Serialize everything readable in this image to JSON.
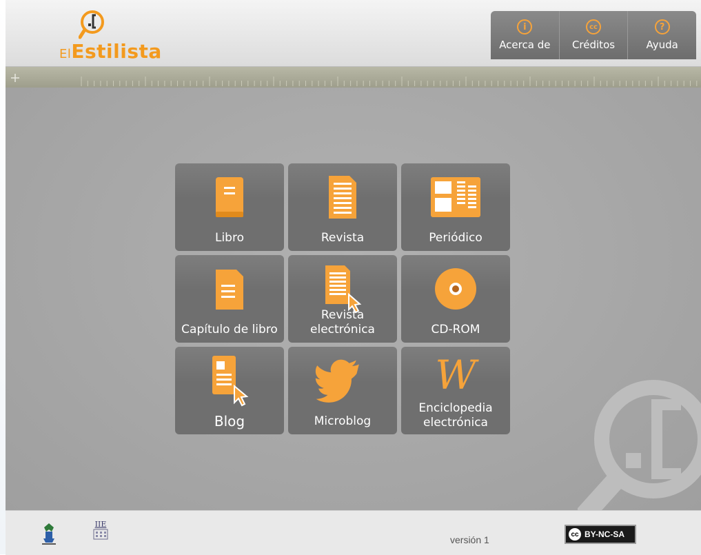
{
  "header": {
    "logo": {
      "prefix": "El",
      "name": "Estilista",
      "mark": ".["
    },
    "nav": [
      {
        "label": "Acerca de",
        "icon": "info-icon",
        "glyph": "i"
      },
      {
        "label": "Créditos",
        "icon": "creative-commons-icon",
        "glyph": "cc"
      },
      {
        "label": "Ayuda",
        "icon": "help-icon",
        "glyph": "?"
      }
    ]
  },
  "tiles": [
    {
      "label": "Libro",
      "icon": "book-icon"
    },
    {
      "label": "Revista",
      "icon": "magazine-icon"
    },
    {
      "label": "Periódico",
      "icon": "newspaper-icon"
    },
    {
      "label": "Capítulo de libro",
      "icon": "book-chapter-icon"
    },
    {
      "label": "Revista electrónica",
      "icon": "e-magazine-icon"
    },
    {
      "label": "CD-ROM",
      "icon": "cd-rom-icon"
    },
    {
      "label": "Blog",
      "icon": "blog-icon"
    },
    {
      "label": "Microblog",
      "icon": "bird-icon"
    },
    {
      "label": "Enciclopedia electrónica",
      "icon": "encyclopedia-w-icon",
      "glyph": "W"
    }
  ],
  "footer": {
    "version": "versión 1",
    "license": {
      "glyph": "cc",
      "label": "BY-NC-SA"
    },
    "logo2_text": "IIE"
  },
  "colors": {
    "accent": "#f39a1e",
    "tile": "#6f6f6f",
    "background": "#a9a9a9"
  }
}
